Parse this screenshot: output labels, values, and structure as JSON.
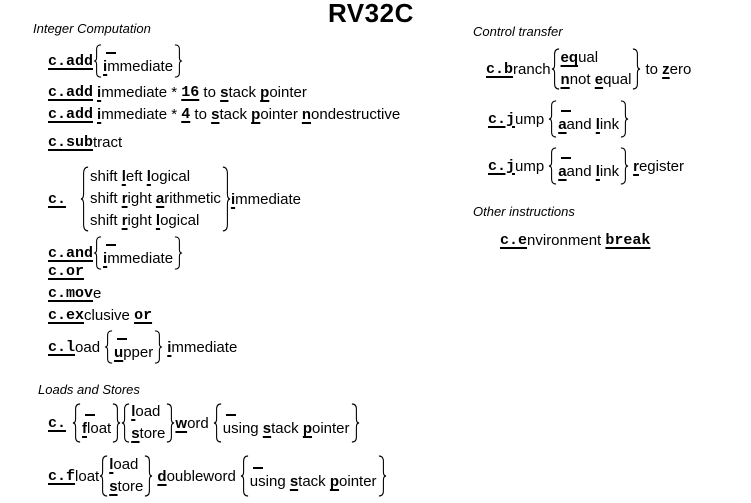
{
  "title": "RV32C",
  "sections": {
    "integer": "Integer Computation",
    "loads": "Loads and Stores",
    "control": "Control transfer",
    "other": "Other instructions"
  },
  "words": {
    "add": "c.add",
    "sub_op": "c.sub",
    "sub_rest": "tract",
    "c_prefix": "c.",
    "and_op": "c.and",
    "or_op": "c.or",
    "mov_op": "c.mov",
    "mov_rest": "e",
    "xor_c": "c.e",
    "xor_x": "x",
    "xor_clusive": "clusive ",
    "xor_or": "or",
    "load_op": "c.l",
    "load_rest": "oad",
    "float_op": "c.f",
    "float_rest": "loat",
    "branch_op": "c.b",
    "branch_rest": "ranch",
    "jump_op": "c.j",
    "jump_rest": "ump",
    "env_op": "c.e",
    "env_rest": "nvironment ",
    "env_break": "break",
    "immediate": "immediate",
    "immediate_rest": "mmediate",
    "i": "i",
    "times16": " * ",
    "num16": "16",
    "num4": "4",
    "to": " to ",
    "s": "s",
    "tack": "tack ",
    "p": "p",
    "ointer": "ointer",
    "n": "n",
    "ondestructive": "ondestructive",
    "shift": "shift ",
    "l": "l",
    "eft": "eft ",
    "ogical": "ogical",
    "r": "r",
    "ight": "ight ",
    "a": "a",
    "rithmetic": "rithmetic",
    "u": "u",
    "pper": "pper",
    "f": "f",
    "loat_w": "loat",
    "oad": "oad",
    "tore": "tore",
    "w": "w",
    "ord": "ord",
    "d": "d",
    "oubleword": "oubleword",
    "using": "using ",
    "eq": "eq",
    "ual": "ual",
    "not": "not ",
    "e": "e",
    "qual": "qual",
    "to_zero_pre": "to ",
    "z": "z",
    "ero": "ero",
    "and": "and ",
    "ink": "ink",
    "egister": "egister"
  }
}
